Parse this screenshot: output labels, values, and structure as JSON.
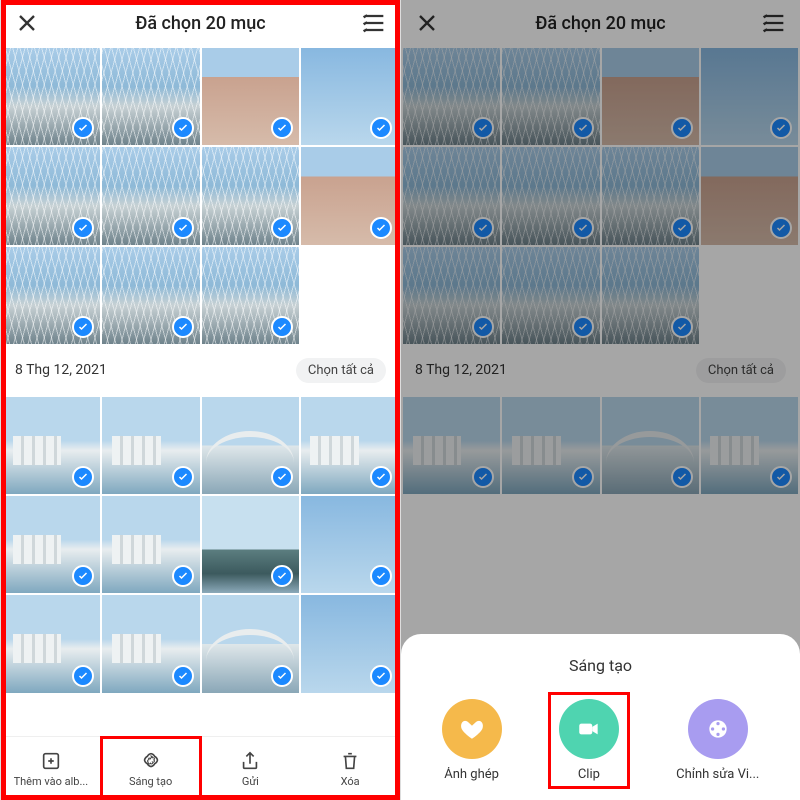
{
  "header": {
    "title": "Đã chọn 20 mục"
  },
  "section": {
    "date": "8 Thg 12, 2021",
    "select_all": "Chọn tất cả"
  },
  "bottom_bar": {
    "items": [
      {
        "label": "Thêm vào alb...",
        "icon": "add-to-album"
      },
      {
        "label": "Sáng tạo",
        "icon": "create"
      },
      {
        "label": "Gửi",
        "icon": "share"
      },
      {
        "label": "Xóa",
        "icon": "delete"
      }
    ]
  },
  "sheet": {
    "title": "Sáng tạo",
    "items": [
      {
        "label": "Ảnh ghép",
        "color": "orange",
        "icon": "heart"
      },
      {
        "label": "Clip",
        "color": "teal",
        "icon": "video"
      },
      {
        "label": "Chỉnh sửa Vi...",
        "color": "purple",
        "icon": "reel"
      }
    ]
  },
  "grid1": {
    "rows": [
      [
        "bridge1",
        "bridge1",
        "sign",
        "sky"
      ],
      [
        "bridge1",
        "bridge1",
        "bridge1",
        "sign"
      ],
      [
        "bridge1",
        "bridge1",
        "bridge1",
        "blank"
      ]
    ],
    "checks": [
      [
        true,
        true,
        true,
        true
      ],
      [
        true,
        true,
        true,
        true
      ],
      [
        true,
        true,
        true,
        false
      ]
    ]
  },
  "grid2": {
    "rows": [
      [
        "city",
        "city",
        "arch",
        "city"
      ],
      [
        "city",
        "city",
        "mount",
        "sky"
      ],
      [
        "city",
        "city",
        "arch",
        "sky"
      ]
    ],
    "checks": [
      [
        true,
        true,
        true,
        true
      ],
      [
        true,
        true,
        true,
        true
      ],
      [
        true,
        true,
        true,
        true
      ]
    ]
  },
  "grid1b": {
    "rows": [
      [
        "bridge1",
        "bridge1",
        "sign",
        "sky"
      ],
      [
        "bridge1",
        "bridge1",
        "bridge1",
        "sign"
      ],
      [
        "bridge1",
        "bridge1",
        "bridge1",
        "blank"
      ]
    ],
    "checks": [
      [
        true,
        true,
        true,
        true
      ],
      [
        true,
        true,
        true,
        true
      ],
      [
        true,
        true,
        true,
        false
      ]
    ]
  },
  "grid2b": {
    "rows": [
      [
        "city",
        "city",
        "arch",
        "city"
      ]
    ],
    "checks": [
      [
        true,
        true,
        true,
        true
      ]
    ]
  }
}
